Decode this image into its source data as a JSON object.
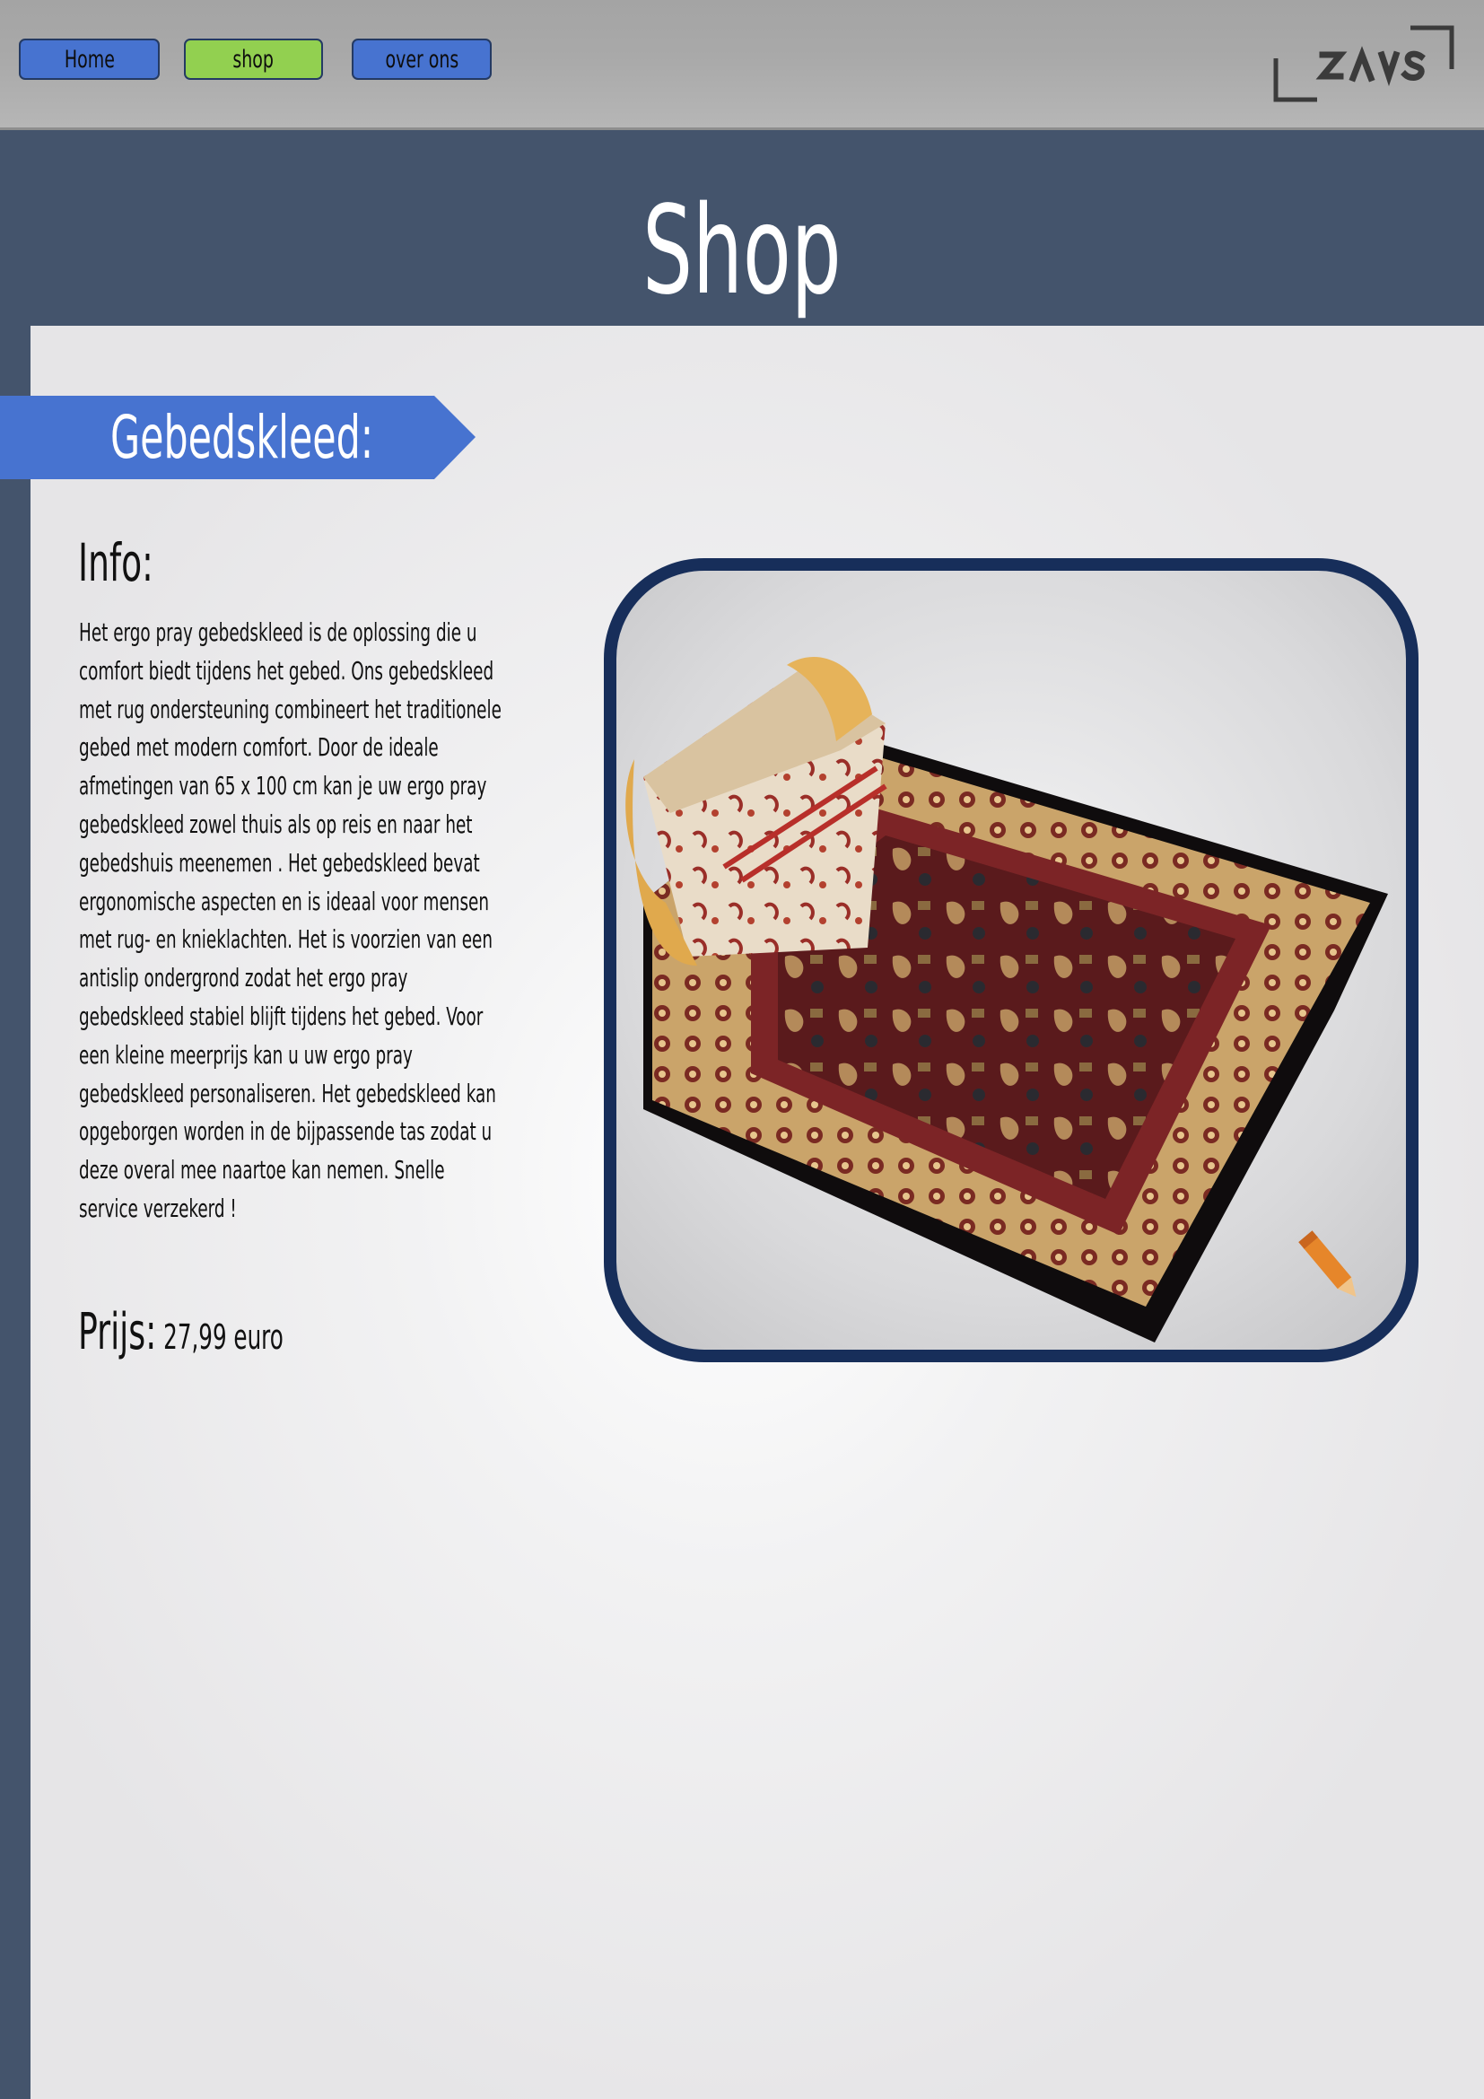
{
  "nav": {
    "home_label": "Home",
    "shop_label": "shop",
    "about_label": "over ons",
    "logo_text": "ZAVS"
  },
  "page": {
    "title": "Shop"
  },
  "product": {
    "name": "Gebedskleed:",
    "info_heading": "Info:",
    "description_lines": [
      " Het ergo pray gebedskleed is de oplossing die u",
      "comfort biedt tijdens het gebed. Ons gebedskleed",
      "met rug ondersteuning combineert het traditionele",
      "gebed met modern comfort. Door de ideale",
      "afmetingen van 65 x 100 cm kan je uw ergo pray",
      "gebedskleed zowel thuis als op reis en naar het",
      "gebedshuis meenemen . Het gebedskleed bevat",
      "ergonomische aspecten en is ideaal voor mensen",
      "met rug- en knieklachten. Het is voorzien van een",
      "antislip ondergrond zodat het ergo pray",
      "gebedskleed stabiel blijft tijdens het gebed. Voor",
      "een kleine meerprijs kan u uw ergo pray",
      "gebedskleed personaliseren. Het gebedskleed kan",
      "opgeborgen worden in de bijpassende tas zodat u",
      "deze overal mee naartoe kan nemen. Snelle",
      "service verzekerd !"
    ],
    "price_label": "Prijs:",
    "price_value": " 27,99 euro",
    "image_icon": "prayer-rug-with-backrest",
    "badge_icon": "pencil-icon"
  },
  "colors": {
    "band": "#44546c",
    "nav_blue": "#4773d0",
    "nav_active": "#92d050",
    "banner": "#4773d0",
    "frame": "#172e5a"
  }
}
